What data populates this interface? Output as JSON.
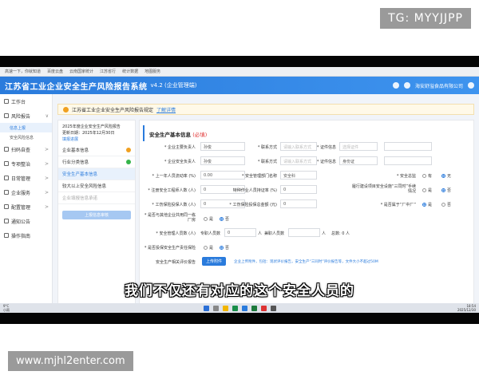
{
  "watermarks": {
    "top": "TG: MYYJJPP",
    "bottom": "www.mjhl2enter.com"
  },
  "browser": {
    "bookmarks": [
      "高速一下，你就知道",
      "百度云盘",
      "云南国家统计",
      "江苏省行",
      "统计数据",
      "地图服务"
    ]
  },
  "header": {
    "title": "江苏省工业企业安全生产风险报告系统",
    "version": "v4.2 (企业管理端)",
    "company": "海安舒溢食品有限公司"
  },
  "sidebar": {
    "items": [
      {
        "label": "工作台",
        "icon": "monitor-icon",
        "chev": ""
      },
      {
        "label": "风险报告",
        "icon": "report-icon",
        "chev": "∨"
      },
      {
        "label": "扫码自查",
        "icon": "qr-icon",
        "chev": ">"
      },
      {
        "label": "专项整治",
        "icon": "shield-icon",
        "chev": ">"
      },
      {
        "label": "日常管理",
        "icon": "calendar-icon",
        "chev": ">"
      },
      {
        "label": "企业服务",
        "icon": "building-icon",
        "chev": ">"
      },
      {
        "label": "配置管理",
        "icon": "gear-icon",
        "chev": ">"
      },
      {
        "label": "通知公告",
        "icon": "bell-icon",
        "chev": ""
      },
      {
        "label": "操作指南",
        "icon": "book-icon",
        "chev": ""
      }
    ],
    "subitems": [
      "信息上报",
      "安全风险信息"
    ]
  },
  "notice": {
    "text": "江苏省工业企业安全生产风险报告规定",
    "link": "了解详情"
  },
  "steps": {
    "title": "2025年度企业安全生产风险报告",
    "date": "更新日期：2025年12月30日",
    "link": "填报进展",
    "items": [
      {
        "label": "企业基本信息",
        "status": "warn"
      },
      {
        "label": "行业分类信息",
        "status": "ok"
      },
      {
        "label": "安全生产基本信息",
        "status": "active"
      },
      {
        "label": "较大以上安全风险信息",
        "status": "none"
      },
      {
        "label": "企业填报信息承诺",
        "status": "disabled"
      }
    ],
    "button": "上报信息审核"
  },
  "form": {
    "title": "安全生产基本信息",
    "required": "(必填)",
    "row1": {
      "label1": "* 企业主要负责人",
      "value1": "孙俊",
      "label2": "* 联系方式",
      "ph2": "请输入联系方式",
      "label3": "* 证件信息",
      "ph3": "选择证件"
    },
    "row2": {
      "label1": "* 企业安全负责人",
      "value1": "孙俊",
      "label2": "* 联系方式",
      "ph2": "请输入联系方式",
      "label3": "* 证件信息",
      "value3": "身份证"
    },
    "row3": {
      "label1": "* 上一年人员流动率 (%)",
      "value1": "0.00",
      "label2": "* 安全管理部门名称",
      "value2": "安全科",
      "label3": "* 安全总监",
      "opt1": "有",
      "opt2": "无"
    },
    "row4": {
      "label1": "* 注册安全工程师人数 (人)",
      "value1": "0",
      "label2": "特种作业人员持证率 (%)",
      "value2": "0",
      "label3": "履行建设项目安全设施“三同时”手续情况",
      "opt1": "是",
      "opt2": "否"
    },
    "row5": {
      "label1": "* 工伤保险投保人数 (人)",
      "value1": "0",
      "label2": "* 工伤保险投保总金额 (元)",
      "value2": "0",
      "label3": "* 是否属于“厂中厂”",
      "opt1": "是",
      "opt2": "否"
    },
    "row6": {
      "label1": "* 是否与其他企业共用同一栋厂房",
      "opt1": "是",
      "opt2": "否"
    },
    "row7": {
      "label1": "* 安全管理人员数 (人)",
      "text1": "专职人员数",
      "value1": "0",
      "unit1": "人",
      "text2": "兼职人员数",
      "unit2": "人",
      "total": "总数: 0 人"
    },
    "row8": {
      "label1": "* 是否投保安全生产责任保险",
      "opt1": "是",
      "opt2": "否"
    },
    "row9": {
      "label1": "安全生产相关评价报告",
      "button": "上传附件",
      "hint": "企业上传附件，包括：现状评价报告，安全生产“三同时”评价报告等，文件大小不超过50M"
    }
  },
  "caption": "我们不仅还有对应的这个安全人员的",
  "taskbar": {
    "weather_temp": "9°C",
    "weather_desc": "小雨",
    "time": "18:54",
    "date": "2025/12/30"
  }
}
